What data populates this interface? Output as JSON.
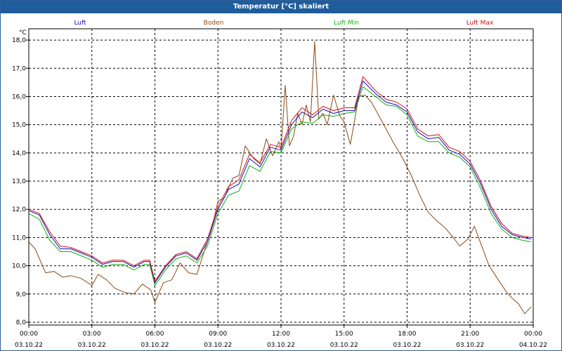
{
  "window": {
    "title": "Temperatur [°C] skaliert"
  },
  "chart_data": {
    "type": "line",
    "title": "Temperatur [°C] skaliert",
    "ylabel": "°C",
    "xlabel": "",
    "ylim": [
      7.9,
      18.4
    ],
    "y_ticks": [
      "18,0",
      "17,0",
      "16,0",
      "15,0",
      "14,0",
      "13,0",
      "12,0",
      "11,0",
      "10,0",
      "9,0",
      "8,0"
    ],
    "y_tick_values": [
      18,
      17,
      16,
      15,
      14,
      13,
      12,
      11,
      10,
      9,
      8
    ],
    "x_ticks": [
      {
        "time": "00:00",
        "date": "03.10.22"
      },
      {
        "time": "03:00",
        "date": "03.10.22"
      },
      {
        "time": "06:00",
        "date": "03.10.22"
      },
      {
        "time": "09:00",
        "date": "03.10.22"
      },
      {
        "time": "12:00",
        "date": "03.10.22"
      },
      {
        "time": "15:00",
        "date": "03.10.22"
      },
      {
        "time": "18:00",
        "date": "03.10.22"
      },
      {
        "time": "21:00",
        "date": "03.10.22"
      },
      {
        "time": "00:00",
        "date": "04.10.22"
      }
    ],
    "grid": true,
    "legend_position": "top",
    "series": [
      {
        "name": "Luft",
        "color": "#1010c0",
        "x": [
          0,
          0.5,
          1,
          1.5,
          2,
          2.5,
          3,
          3.5,
          4,
          4.5,
          5,
          5.5,
          5.75,
          6,
          6.5,
          7,
          7.5,
          8,
          8.5,
          9,
          9.5,
          10,
          10.5,
          11,
          11.5,
          12,
          12.5,
          13,
          13.5,
          14,
          14.5,
          15,
          15.5,
          15.9,
          16.5,
          17,
          17.5,
          18,
          18.5,
          19,
          19.5,
          20,
          20.5,
          21,
          21.5,
          22,
          22.5,
          23,
          23.5,
          23.9
        ],
        "values": [
          11.95,
          11.8,
          11.1,
          10.6,
          10.6,
          10.45,
          10.3,
          10.05,
          10.15,
          10.15,
          9.95,
          10.15,
          10.15,
          9.4,
          9.95,
          10.35,
          10.45,
          10.2,
          10.85,
          12.0,
          12.7,
          12.9,
          13.8,
          13.5,
          14.2,
          14.1,
          15.0,
          15.45,
          15.25,
          15.55,
          15.4,
          15.5,
          15.5,
          16.55,
          16.1,
          15.8,
          15.7,
          15.45,
          14.75,
          14.5,
          14.55,
          14.1,
          13.95,
          13.6,
          12.9,
          12.0,
          11.4,
          11.1,
          11.0,
          10.95
        ]
      },
      {
        "name": "Boden",
        "color": "#8b4a14",
        "x": [
          0,
          0.3,
          0.8,
          1.2,
          1.6,
          2.0,
          2.5,
          3.0,
          3.3,
          3.7,
          4.1,
          4.6,
          5.0,
          5.4,
          5.8,
          6.0,
          6.4,
          6.8,
          7.2,
          7.6,
          8.0,
          8.3,
          8.7,
          9.0,
          9.3,
          9.7,
          10.0,
          10.3,
          10.7,
          11.0,
          11.3,
          11.6,
          11.9,
          12.0,
          12.2,
          12.4,
          12.6,
          12.8,
          13.0,
          13.2,
          13.4,
          13.6,
          13.8,
          14.0,
          14.2,
          14.5,
          14.8,
          15.0,
          15.3,
          15.7,
          16.0,
          16.3,
          16.6,
          17.0,
          17.4,
          17.8,
          18.2,
          18.6,
          19.0,
          19.4,
          19.8,
          20.2,
          20.5,
          20.9,
          21.2,
          21.5,
          21.9,
          22.3,
          22.7,
          23.0,
          23.3,
          23.6,
          23.9
        ],
        "values": [
          10.85,
          10.6,
          9.75,
          9.8,
          9.6,
          9.65,
          9.55,
          9.3,
          9.7,
          9.5,
          9.2,
          9.05,
          9.0,
          9.35,
          9.15,
          8.7,
          9.4,
          9.5,
          10.1,
          9.75,
          9.7,
          10.4,
          11.3,
          12.3,
          12.4,
          13.1,
          13.2,
          14.25,
          13.8,
          13.6,
          14.5,
          13.9,
          14.4,
          14.1,
          16.4,
          14.25,
          14.6,
          15.4,
          15.0,
          15.7,
          15.1,
          17.95,
          15.2,
          15.4,
          15.0,
          16.05,
          15.3,
          15.1,
          14.3,
          16.0,
          16.05,
          15.8,
          15.4,
          14.85,
          14.3,
          13.8,
          13.2,
          12.5,
          11.9,
          11.6,
          11.35,
          11.0,
          10.7,
          10.95,
          11.4,
          10.8,
          10.0,
          9.55,
          9.1,
          8.85,
          8.65,
          8.3,
          8.55
        ]
      },
      {
        "name": "Luft Min",
        "color": "#10b010",
        "x": [
          0,
          0.5,
          1,
          1.5,
          2,
          2.5,
          3,
          3.5,
          4,
          4.5,
          5,
          5.5,
          5.75,
          6,
          6.5,
          7,
          7.5,
          8,
          8.5,
          9,
          9.5,
          10,
          10.5,
          11,
          11.5,
          12,
          12.5,
          13,
          13.5,
          14,
          14.5,
          15,
          15.5,
          15.9,
          16.5,
          17,
          17.5,
          18,
          18.5,
          19,
          19.5,
          20,
          20.5,
          21,
          21.5,
          22,
          22.5,
          23,
          23.5,
          23.9
        ],
        "values": [
          11.85,
          11.65,
          10.9,
          10.5,
          10.5,
          10.35,
          10.2,
          9.95,
          10.05,
          10.05,
          9.85,
          10.05,
          10.05,
          9.3,
          9.85,
          10.25,
          10.35,
          10.1,
          10.7,
          11.85,
          12.5,
          12.65,
          13.55,
          13.35,
          14.05,
          14.0,
          14.85,
          15.1,
          15.05,
          15.35,
          15.3,
          15.4,
          15.45,
          16.35,
          16.0,
          15.7,
          15.65,
          15.35,
          14.6,
          14.4,
          14.4,
          14.0,
          13.85,
          13.5,
          12.75,
          11.85,
          11.3,
          11.0,
          10.9,
          10.85
        ]
      },
      {
        "name": "Luft Max",
        "color": "#d01010",
        "x": [
          0,
          0.5,
          1,
          1.5,
          2,
          2.5,
          3,
          3.5,
          4,
          4.5,
          5,
          5.5,
          5.75,
          6,
          6.5,
          7,
          7.5,
          8,
          8.5,
          9,
          9.5,
          10,
          10.5,
          11,
          11.5,
          12,
          12.5,
          13,
          13.5,
          14,
          14.5,
          15,
          15.5,
          15.9,
          16.5,
          17,
          17.5,
          18,
          18.5,
          19,
          19.5,
          20,
          20.5,
          21,
          21.5,
          22,
          22.5,
          23,
          23.5,
          23.9
        ],
        "values": [
          12.0,
          11.85,
          11.2,
          10.7,
          10.65,
          10.5,
          10.35,
          10.1,
          10.2,
          10.2,
          10.0,
          10.2,
          10.2,
          9.45,
          10.0,
          10.4,
          10.5,
          10.25,
          10.95,
          12.1,
          12.8,
          13.05,
          13.95,
          13.65,
          14.3,
          14.2,
          15.15,
          15.6,
          15.35,
          15.65,
          15.5,
          15.6,
          15.6,
          16.7,
          16.2,
          15.9,
          15.8,
          15.55,
          14.85,
          14.6,
          14.65,
          14.2,
          14.05,
          13.7,
          13.0,
          12.1,
          11.5,
          11.15,
          11.05,
          11.0
        ]
      }
    ]
  }
}
